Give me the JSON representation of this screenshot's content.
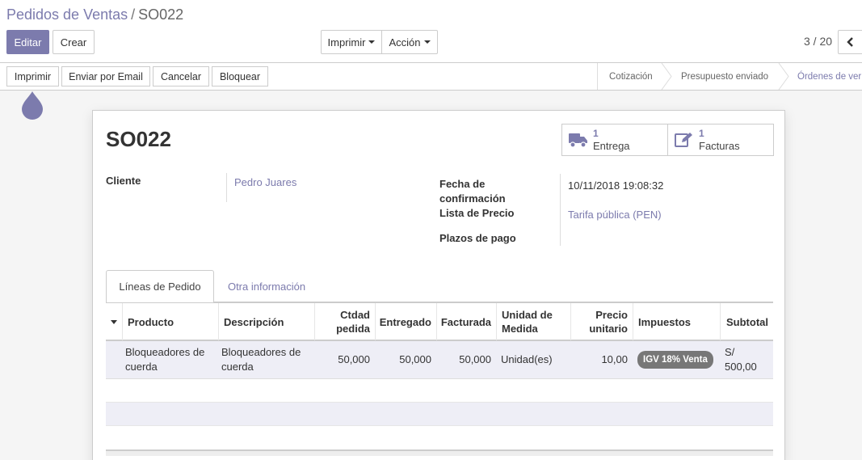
{
  "breadcrumb": {
    "parent": "Pedidos de Ventas",
    "separator": "/",
    "current": "SO022"
  },
  "toolbar": {
    "edit_label": "Editar",
    "create_label": "Crear",
    "print_label": "Imprimir",
    "action_label": "Acción"
  },
  "pager": {
    "value": "3 / 20"
  },
  "statusbar": {
    "buttons": [
      "Imprimir",
      "Enviar por Email",
      "Cancelar",
      "Bloquear"
    ],
    "stages": [
      "Cotización",
      "Presupuesto enviado",
      "Órdenes de ver"
    ],
    "current_stage": "Órdenes de venta"
  },
  "record": {
    "name": "SO022",
    "smart_buttons": [
      {
        "count": "1",
        "label": "Entrega",
        "icon": "truck-icon"
      },
      {
        "count": "1",
        "label": "Facturas",
        "icon": "edit-icon"
      }
    ],
    "customer_label": "Cliente",
    "customer_value": "Pedro Juares",
    "confirm_label_1": "Fecha de",
    "confirm_label_2": "confirmación",
    "confirm_value": "10/11/2018 19:08:32",
    "pricelist_label": "Lista de Precio",
    "pricelist_value": "Tarifa pública (PEN)",
    "payment_terms_label": "Plazos de pago"
  },
  "tabs": [
    "Líneas de Pedido",
    "Otra información"
  ],
  "table": {
    "headers": {
      "product": "Producto",
      "description": "Descripción",
      "qty_1": "Ctdad",
      "qty_2": "pedida",
      "delivered": "Entregado",
      "invoiced": "Facturada",
      "uom_1": "Unidad de",
      "uom_2": "Medida",
      "price_1": "Precio",
      "price_2": "unitario",
      "taxes": "Impuestos",
      "subtotal": "Subtotal"
    },
    "rows": [
      {
        "product_1": "Bloqueadores de",
        "product_2": "cuerda",
        "description_1": "Bloqueadores de",
        "description_2": "cuerda",
        "qty": "50,000",
        "delivered": "50,000",
        "invoiced": "50,000",
        "uom": "Unidad(es)",
        "price": "10,00",
        "tax": "IGV 18% Venta",
        "subtotal": "S/ 500,00"
      }
    ]
  },
  "colors": {
    "brand": "#7c7bad",
    "badge": "#777777"
  }
}
